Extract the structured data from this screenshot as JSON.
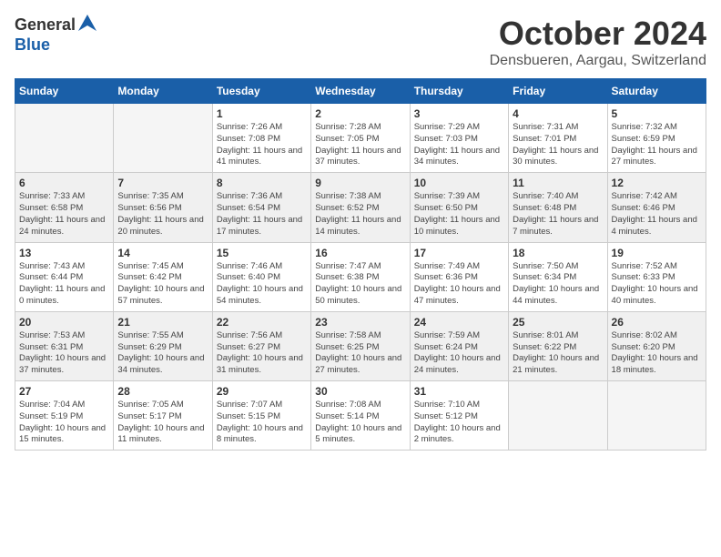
{
  "logo": {
    "general": "General",
    "blue": "Blue"
  },
  "title": "October 2024",
  "location": "Densbueren, Aargau, Switzerland",
  "weekdays": [
    "Sunday",
    "Monday",
    "Tuesday",
    "Wednesday",
    "Thursday",
    "Friday",
    "Saturday"
  ],
  "weeks": [
    [
      {
        "day": "",
        "info": ""
      },
      {
        "day": "",
        "info": ""
      },
      {
        "day": "1",
        "info": "Sunrise: 7:26 AM\nSunset: 7:08 PM\nDaylight: 11 hours and 41 minutes."
      },
      {
        "day": "2",
        "info": "Sunrise: 7:28 AM\nSunset: 7:05 PM\nDaylight: 11 hours and 37 minutes."
      },
      {
        "day": "3",
        "info": "Sunrise: 7:29 AM\nSunset: 7:03 PM\nDaylight: 11 hours and 34 minutes."
      },
      {
        "day": "4",
        "info": "Sunrise: 7:31 AM\nSunset: 7:01 PM\nDaylight: 11 hours and 30 minutes."
      },
      {
        "day": "5",
        "info": "Sunrise: 7:32 AM\nSunset: 6:59 PM\nDaylight: 11 hours and 27 minutes."
      }
    ],
    [
      {
        "day": "6",
        "info": "Sunrise: 7:33 AM\nSunset: 6:58 PM\nDaylight: 11 hours and 24 minutes."
      },
      {
        "day": "7",
        "info": "Sunrise: 7:35 AM\nSunset: 6:56 PM\nDaylight: 11 hours and 20 minutes."
      },
      {
        "day": "8",
        "info": "Sunrise: 7:36 AM\nSunset: 6:54 PM\nDaylight: 11 hours and 17 minutes."
      },
      {
        "day": "9",
        "info": "Sunrise: 7:38 AM\nSunset: 6:52 PM\nDaylight: 11 hours and 14 minutes."
      },
      {
        "day": "10",
        "info": "Sunrise: 7:39 AM\nSunset: 6:50 PM\nDaylight: 11 hours and 10 minutes."
      },
      {
        "day": "11",
        "info": "Sunrise: 7:40 AM\nSunset: 6:48 PM\nDaylight: 11 hours and 7 minutes."
      },
      {
        "day": "12",
        "info": "Sunrise: 7:42 AM\nSunset: 6:46 PM\nDaylight: 11 hours and 4 minutes."
      }
    ],
    [
      {
        "day": "13",
        "info": "Sunrise: 7:43 AM\nSunset: 6:44 PM\nDaylight: 11 hours and 0 minutes."
      },
      {
        "day": "14",
        "info": "Sunrise: 7:45 AM\nSunset: 6:42 PM\nDaylight: 10 hours and 57 minutes."
      },
      {
        "day": "15",
        "info": "Sunrise: 7:46 AM\nSunset: 6:40 PM\nDaylight: 10 hours and 54 minutes."
      },
      {
        "day": "16",
        "info": "Sunrise: 7:47 AM\nSunset: 6:38 PM\nDaylight: 10 hours and 50 minutes."
      },
      {
        "day": "17",
        "info": "Sunrise: 7:49 AM\nSunset: 6:36 PM\nDaylight: 10 hours and 47 minutes."
      },
      {
        "day": "18",
        "info": "Sunrise: 7:50 AM\nSunset: 6:34 PM\nDaylight: 10 hours and 44 minutes."
      },
      {
        "day": "19",
        "info": "Sunrise: 7:52 AM\nSunset: 6:33 PM\nDaylight: 10 hours and 40 minutes."
      }
    ],
    [
      {
        "day": "20",
        "info": "Sunrise: 7:53 AM\nSunset: 6:31 PM\nDaylight: 10 hours and 37 minutes."
      },
      {
        "day": "21",
        "info": "Sunrise: 7:55 AM\nSunset: 6:29 PM\nDaylight: 10 hours and 34 minutes."
      },
      {
        "day": "22",
        "info": "Sunrise: 7:56 AM\nSunset: 6:27 PM\nDaylight: 10 hours and 31 minutes."
      },
      {
        "day": "23",
        "info": "Sunrise: 7:58 AM\nSunset: 6:25 PM\nDaylight: 10 hours and 27 minutes."
      },
      {
        "day": "24",
        "info": "Sunrise: 7:59 AM\nSunset: 6:24 PM\nDaylight: 10 hours and 24 minutes."
      },
      {
        "day": "25",
        "info": "Sunrise: 8:01 AM\nSunset: 6:22 PM\nDaylight: 10 hours and 21 minutes."
      },
      {
        "day": "26",
        "info": "Sunrise: 8:02 AM\nSunset: 6:20 PM\nDaylight: 10 hours and 18 minutes."
      }
    ],
    [
      {
        "day": "27",
        "info": "Sunrise: 7:04 AM\nSunset: 5:19 PM\nDaylight: 10 hours and 15 minutes."
      },
      {
        "day": "28",
        "info": "Sunrise: 7:05 AM\nSunset: 5:17 PM\nDaylight: 10 hours and 11 minutes."
      },
      {
        "day": "29",
        "info": "Sunrise: 7:07 AM\nSunset: 5:15 PM\nDaylight: 10 hours and 8 minutes."
      },
      {
        "day": "30",
        "info": "Sunrise: 7:08 AM\nSunset: 5:14 PM\nDaylight: 10 hours and 5 minutes."
      },
      {
        "day": "31",
        "info": "Sunrise: 7:10 AM\nSunset: 5:12 PM\nDaylight: 10 hours and 2 minutes."
      },
      {
        "day": "",
        "info": ""
      },
      {
        "day": "",
        "info": ""
      }
    ]
  ]
}
